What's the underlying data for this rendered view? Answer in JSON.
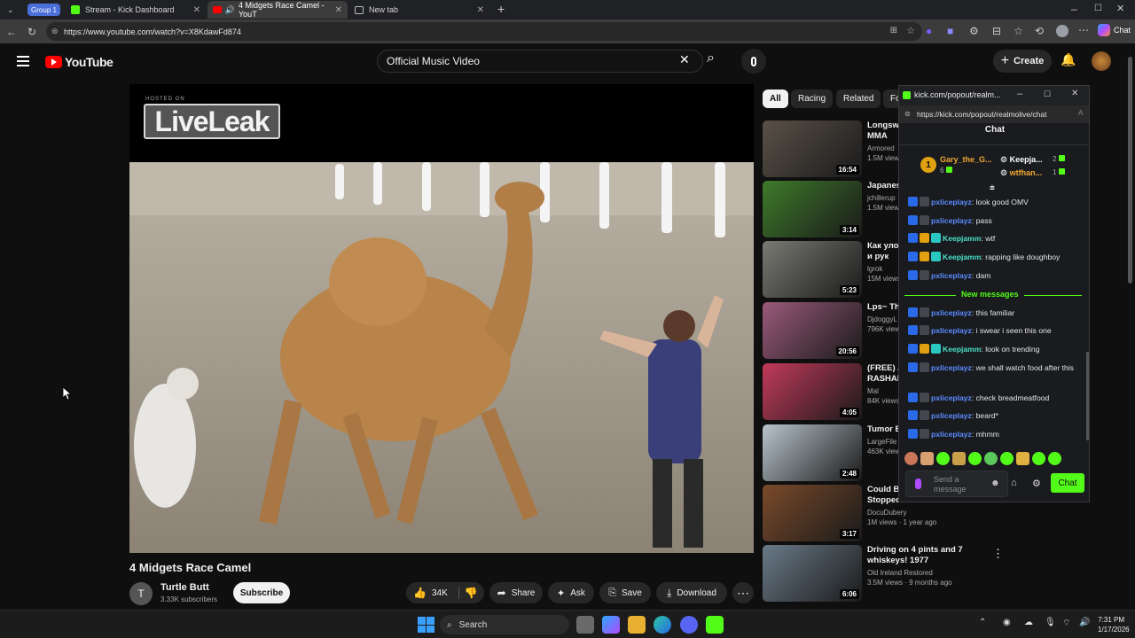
{
  "browser": {
    "tabs": [
      {
        "label": "Group 1"
      },
      {
        "label": "Stream - Kick Dashboard"
      },
      {
        "label": "4 Midgets Race Camel - YouT"
      },
      {
        "label": "New tab"
      }
    ],
    "url": "https://www.youtube.com/watch?v=X8KdawFd874",
    "copilot_label": "Chat"
  },
  "youtube": {
    "logo_text": "YouTube",
    "search_value": "Official Music Video",
    "create_label": "Create",
    "video": {
      "watermark_small": "HOSTED ON",
      "watermark": "LiveLeak",
      "title": "4 Midgets Race Camel",
      "channel": "Turtle Butt",
      "channel_initial": "T",
      "subscribers": "3.33K subscribers",
      "subscribe_label": "Subscribe",
      "likes": "34K",
      "share_label": "Share",
      "ask_label": "Ask",
      "save_label": "Save",
      "download_label": "Download"
    },
    "chips": [
      "All",
      "Racing",
      "Related",
      "Fo"
    ],
    "recs": [
      {
        "title": "Longswo\nMMA",
        "channel": "Armored",
        "views": "1.5M views",
        "duration": "16:54",
        "color": "#5a5148"
      },
      {
        "title": "Japanese",
        "channel": "jchillerup",
        "views": "1.5M views",
        "duration": "3:14",
        "color": "#3e7a2a"
      },
      {
        "title": "Как улох\nи рук",
        "channel": "lgrok",
        "views": "15M views",
        "duration": "5:23",
        "color": "#7a7a74"
      },
      {
        "title": "Lps~ Th",
        "channel": "DjdoggyL",
        "views": "796K views",
        "duration": "20:56",
        "color": "#9a5a7a"
      },
      {
        "title": "(FREE) A\nRASHAD",
        "channel": "Mal",
        "views": "84K views",
        "duration": "4:05",
        "color": "#c23a5a"
      },
      {
        "title": "Tumor B",
        "channel": "LargeFile",
        "views": "463K views",
        "duration": "2:48",
        "color": "#b8c4cc"
      },
      {
        "title": "Could Br\nStopped",
        "channel": "DocuDubery",
        "views": "1M views · 1 year ago",
        "duration": "3:17",
        "color": "#7a4a2a"
      },
      {
        "title": "Driving on 4 pints and 7\nwhiskeys! 1977",
        "channel": "Old Ireland Restored",
        "views": "3.5M views · 9 months ago",
        "duration": "6:06",
        "color": "#6a7a88"
      }
    ]
  },
  "kick": {
    "window_title": "kick.com/popout/realm...",
    "url": "https://kick.com/popout/realmolive/chat",
    "header": "Chat",
    "top_gifter": {
      "rank": "1",
      "name": "Gary_the_G...",
      "count": "6"
    },
    "leaders": [
      {
        "name": "Keepja...",
        "count": "2"
      },
      {
        "name": "wtfhan...",
        "count": "1"
      }
    ],
    "messages_before": [
      {
        "user": "pxliceplayz",
        "text": ": look good OMV",
        "color": "#5b8cff"
      },
      {
        "user": "pxliceplayz",
        "text": ": pass",
        "color": "#5b8cff"
      },
      {
        "user": "Keepjamm",
        "text": ": wtf",
        "color": "#4be0c8"
      },
      {
        "user": "Keepjamm",
        "text": ": rapping like doughboy",
        "color": "#4be0c8"
      },
      {
        "user": "pxliceplayz",
        "text": ": dam",
        "color": "#5b8cff"
      }
    ],
    "new_messages_label": "New messages",
    "messages_after": [
      {
        "user": "pxliceplayz",
        "text": ": this familiar",
        "color": "#5b8cff"
      },
      {
        "user": "pxliceplayz",
        "text": ": i swear i seen this one",
        "color": "#5b8cff"
      },
      {
        "user": "Keepjamm",
        "text": ": look on trending",
        "color": "#4be0c8"
      },
      {
        "user": "pxliceplayz",
        "text": ": we shall watch food after this",
        "color": "#5b8cff"
      },
      {
        "user": "pxliceplayz",
        "text": ": check breadmeatfood",
        "color": "#5b8cff"
      },
      {
        "user": "pxliceplayz",
        "text": ": beard*",
        "color": "#5b8cff"
      },
      {
        "user": "pxliceplayz",
        "text": ": mhmm",
        "color": "#5b8cff"
      }
    ],
    "input_placeholder": "Send a message",
    "send_label": "Chat",
    "accent": "#53fc18"
  },
  "taskbar": {
    "search_label": "Search",
    "time": "7:31 PM",
    "date": "1/17/2026"
  }
}
